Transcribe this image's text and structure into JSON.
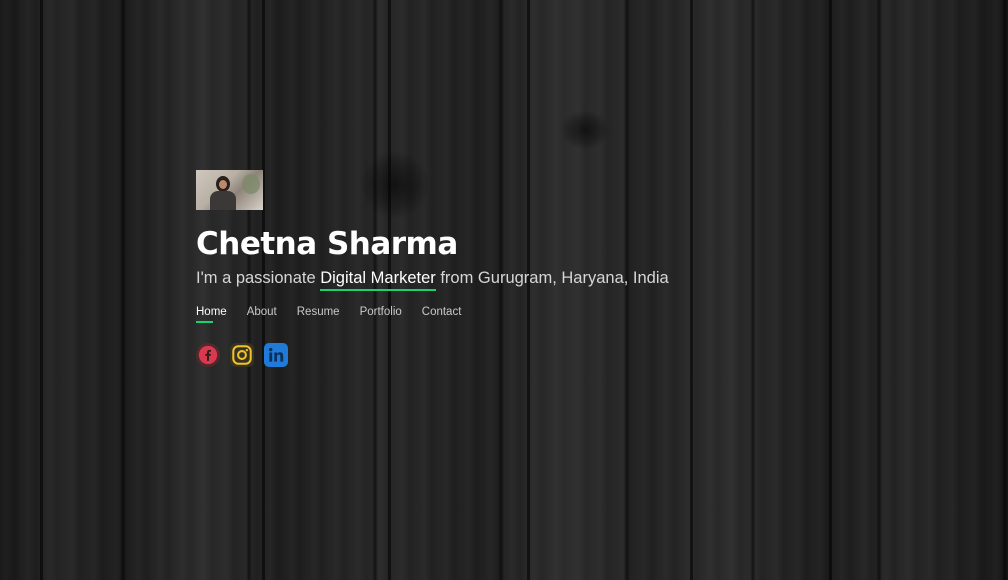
{
  "profile": {
    "name": "Chetna Sharma",
    "tagline_prefix": "I'm a passionate ",
    "tagline_role": "Digital Marketer",
    "tagline_suffix": " from Gurugram, Haryana, India"
  },
  "nav": {
    "items": [
      {
        "label": "Home",
        "active": true
      },
      {
        "label": "About",
        "active": false
      },
      {
        "label": "Resume",
        "active": false
      },
      {
        "label": "Portfolio",
        "active": false
      },
      {
        "label": "Contact",
        "active": false
      }
    ]
  },
  "social": {
    "icons": [
      "facebook-icon",
      "instagram-icon",
      "linkedin-icon"
    ]
  },
  "colors": {
    "accent": "#18d26e",
    "facebook": "#d8394f",
    "instagram": "#f2c12e",
    "linkedin": "#1f7ad8"
  }
}
